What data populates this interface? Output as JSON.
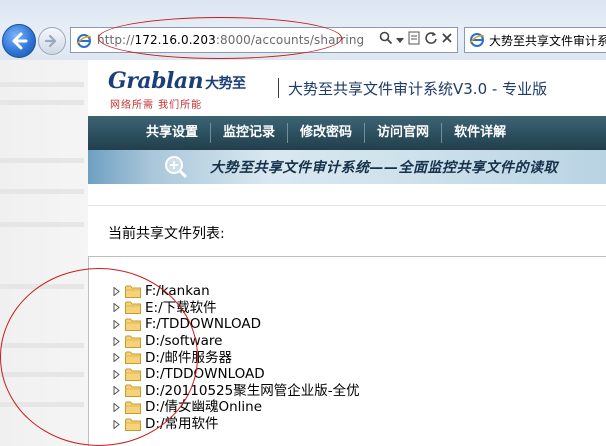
{
  "browser": {
    "address": {
      "protocol": "http://",
      "host": "172.16.0.203",
      "rest": ":8000/accounts/sharring"
    },
    "tab_title": "大势至共享文件审计系"
  },
  "site": {
    "logo_text": "Grablan",
    "logo_cn": "大势至",
    "logo_slogan": "网络所需 我们所能",
    "system_title": "大势至共享文件审计系统V3.0 - 专业版",
    "nav": [
      "共享设置",
      "监控记录",
      "修改密码",
      "访问官网",
      "软件详解"
    ],
    "banner_text": "大势至共享文件审计系统——全面监控共享文件的读取"
  },
  "share_list": {
    "title": "当前共享文件列表:",
    "items": [
      "F:/kankan",
      "E:/下载软件",
      "F:/TDDOWNLOAD",
      "D:/software",
      "D:/邮件服务器",
      "D:/TDDOWNLOAD",
      "D:/20110525聚生网管企业版-全优",
      "D:/倩女幽魂Online",
      "D:/常用软件"
    ]
  },
  "colors": {
    "annotation_red": "#c81e1e",
    "navbar": "#2c4f5e",
    "brand_blue": "#1c3f7a"
  }
}
